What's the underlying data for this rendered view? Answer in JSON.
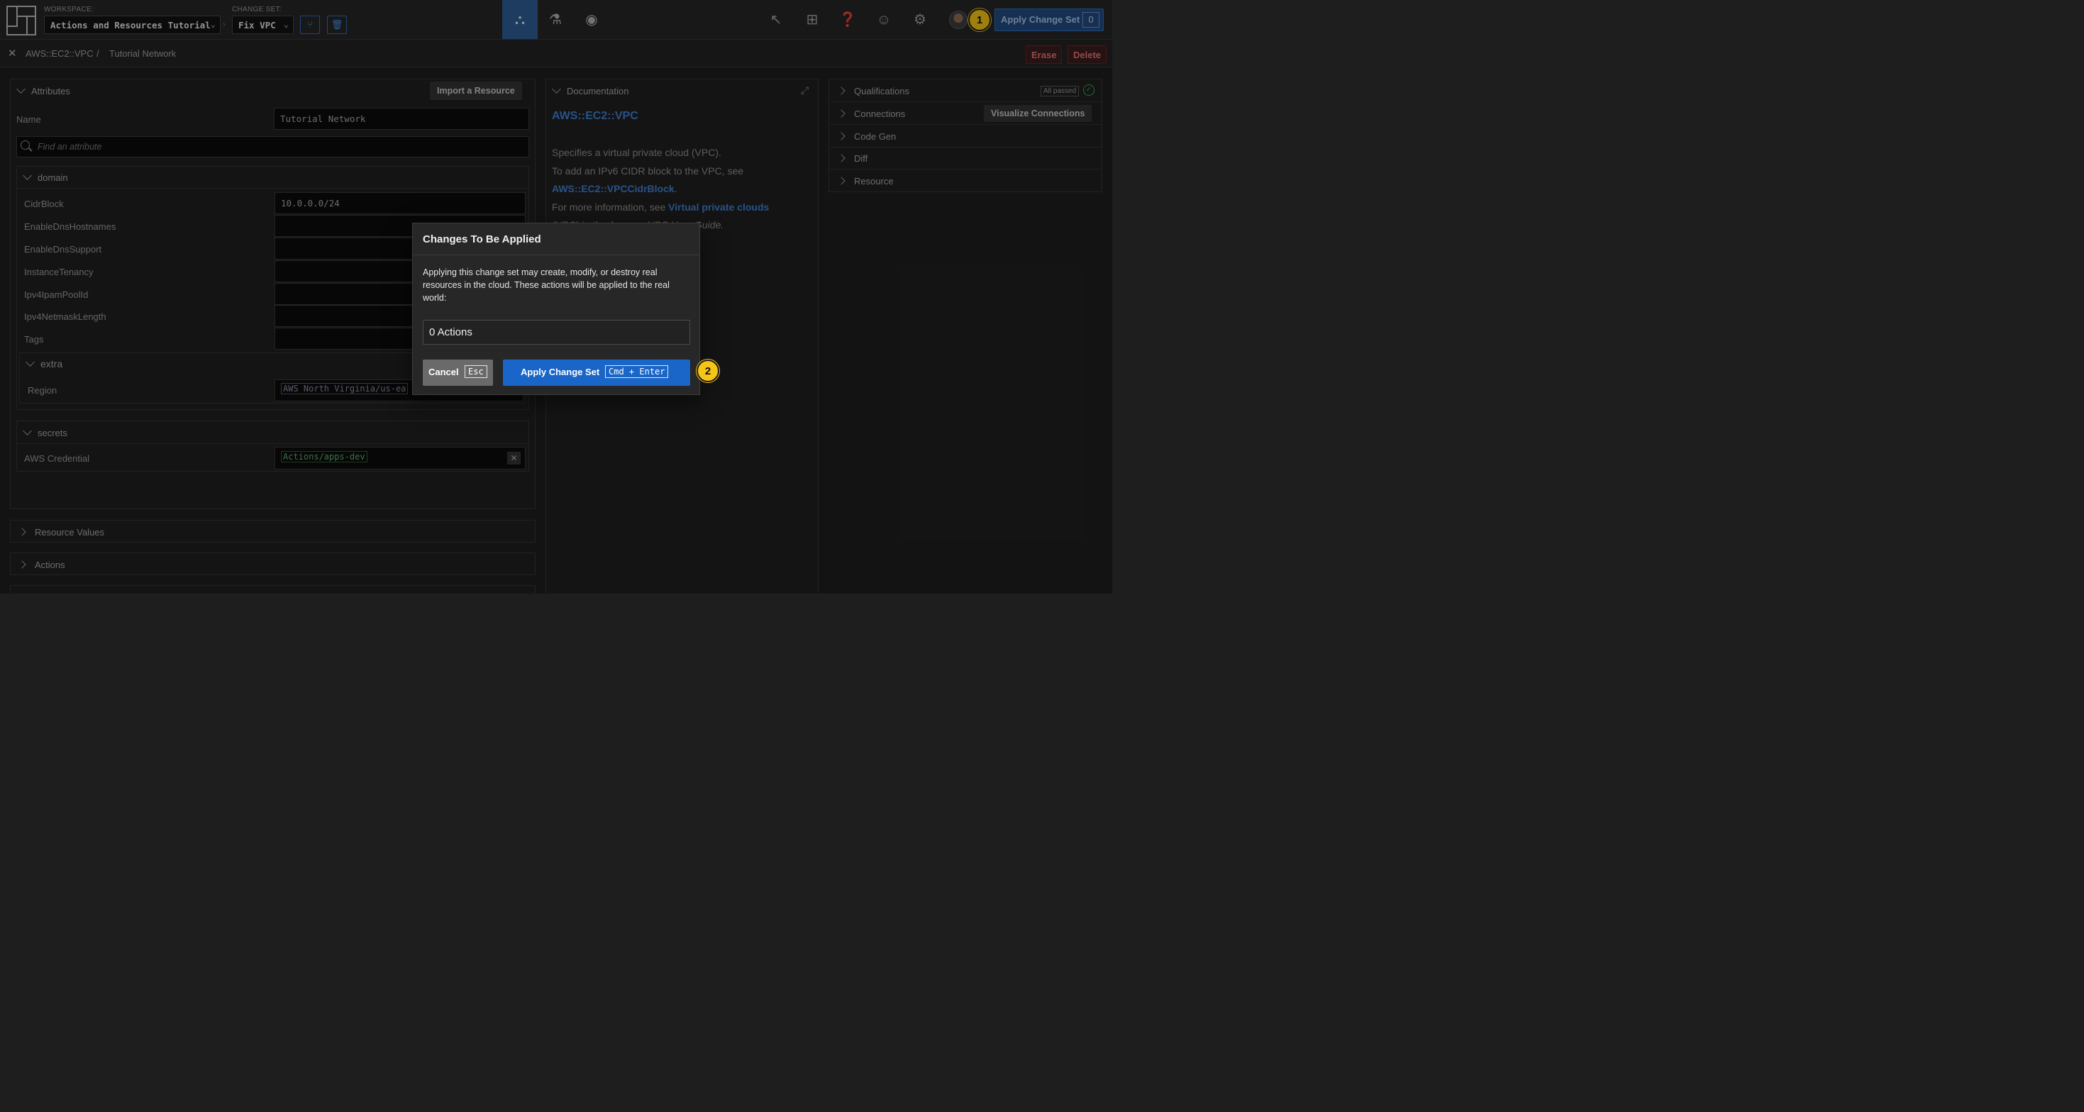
{
  "topbar": {
    "workspace_label": "WORKSPACE:",
    "workspace_value": "Actions and Resources Tutorial",
    "changeset_label": "CHANGE SET:",
    "changeset_value": "Fix VPC",
    "apply_label": "Apply Change Set",
    "apply_count": "0",
    "badge_1": "1"
  },
  "breadcrumb": {
    "type": "AWS::EC2::VPC",
    "separator": "/",
    "name": "Tutorial Network",
    "erase_label": "Erase",
    "delete_label": "Delete"
  },
  "attributes": {
    "title": "Attributes",
    "import_label": "Import a Resource",
    "name_label": "Name",
    "name_value": "Tutorial Network",
    "search_placeholder": "Find an attribute",
    "domain": {
      "title": "domain",
      "rows": [
        {
          "label": "CidrBlock",
          "value": "10.0.0.0/24"
        },
        {
          "label": "EnableDnsHostnames",
          "value": ""
        },
        {
          "label": "EnableDnsSupport",
          "value": ""
        },
        {
          "label": "InstanceTenancy",
          "value": ""
        },
        {
          "label": "Ipv4IpamPoolId",
          "value": ""
        },
        {
          "label": "Ipv4NetmaskLength",
          "value": ""
        },
        {
          "label": "Tags",
          "value": ""
        }
      ]
    },
    "extra": {
      "title": "extra",
      "region_label": "Region",
      "region_value": "AWS North Virginia/us-ea"
    },
    "secrets": {
      "title": "secrets",
      "credential_label": "AWS Credential",
      "credential_value": "Actions/apps-dev"
    },
    "resource_values": "Resource Values",
    "actions": "Actions"
  },
  "documentation": {
    "title": "Documentation",
    "heading": "AWS::EC2::VPC",
    "line1": "Specifies a virtual private cloud (VPC).",
    "line2": "To add an IPv6 CIDR block to the VPC, see",
    "link1": "AWS::EC2::VPCCidrBlock",
    "line3_pre": "For more information, see ",
    "link2": "Virtual private clouds",
    "line4": "(VPC) in the Amazon VPC User Guide."
  },
  "right_panel": {
    "qualifications": "Qualifications",
    "all_passed": "All passed",
    "connections": "Connections",
    "visualize_label": "Visualize Connections",
    "code_gen": "Code Gen",
    "diff": "Diff",
    "resource": "Resource"
  },
  "modal": {
    "title": "Changes To Be Applied",
    "body": "Applying this change set may create, modify, or destroy real resources in the cloud. These actions will be applied to the real world:",
    "actions_count": "0 Actions",
    "cancel_label": "Cancel",
    "cancel_key": "Esc",
    "apply_label": "Apply Change Set",
    "apply_key": "Cmd + Enter",
    "badge_2": "2"
  },
  "colors": {
    "accent": "#1a66c8",
    "active_tab": "#2e5c94",
    "badge": "#f5c518",
    "danger": "#e07070",
    "link": "#3f7fcf"
  }
}
